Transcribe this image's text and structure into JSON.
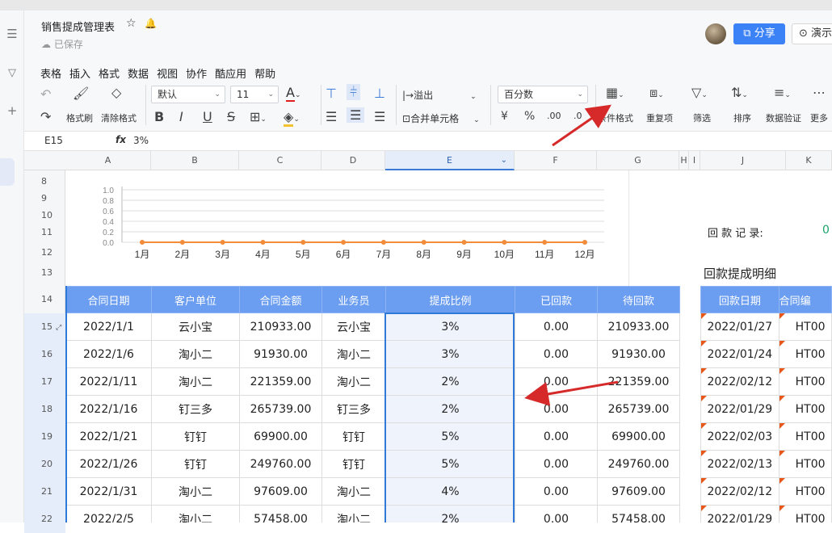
{
  "doc": {
    "title": "销售提成管理表",
    "saved": "已保存",
    "star_glyph": "☆",
    "bell_glyph": "🔔"
  },
  "header": {
    "share": "分享",
    "present": "演示"
  },
  "menu": [
    "表格",
    "插入",
    "格式",
    "数据",
    "视图",
    "协作",
    "酷应用",
    "帮助"
  ],
  "toolbar": {
    "format_painter": "格式刷",
    "clear_format": "清除格式",
    "font": "默认",
    "size": "11",
    "overflow": "溢出",
    "merge": "合并单元格",
    "number_format": "百分数",
    "cond_format": "条件格式",
    "duplicate": "重复项",
    "filter": "筛选",
    "sort": "排序",
    "validate": "数据验证",
    "more": "更多"
  },
  "formula_bar": {
    "cell": "E15",
    "fx": "fx",
    "value": "3%"
  },
  "columns": [
    {
      "id": "A"
    },
    {
      "id": "B"
    },
    {
      "id": "C"
    },
    {
      "id": "D"
    },
    {
      "id": "E"
    },
    {
      "id": "F"
    },
    {
      "id": "G"
    },
    {
      "id": "H"
    },
    {
      "id": "I"
    },
    {
      "id": "J"
    },
    {
      "id": "K"
    }
  ],
  "row_numbers": [
    "8",
    "9",
    "10",
    "11",
    "12",
    "13",
    "14",
    "15",
    "16",
    "17",
    "18",
    "19",
    "20",
    "21",
    "22"
  ],
  "chart_data": {
    "type": "line",
    "categories": [
      "1月",
      "2月",
      "3月",
      "4月",
      "5月",
      "6月",
      "7月",
      "8月",
      "9月",
      "10月",
      "11月",
      "12月"
    ],
    "series": [
      {
        "values": [
          0,
          0,
          0,
          0,
          0,
          0,
          0,
          0,
          0,
          0,
          0,
          0
        ],
        "color": "#f28c3a"
      }
    ],
    "y_ticks": [
      "1.0",
      "0.8",
      "0.6",
      "0.4",
      "0.2",
      "0.0"
    ],
    "ylim": [
      0,
      1.0
    ],
    "grid": true
  },
  "side": {
    "payment_label": "回 款 记 录:",
    "payment_value": "0",
    "detail_title": "回款提成明细"
  },
  "main_table": {
    "headers": [
      "合同日期",
      "客户单位",
      "合同金额",
      "业务员",
      "提成比例",
      "已回款",
      "待回款"
    ],
    "rows": [
      [
        "2022/1/1",
        "云小宝",
        "210933.00",
        "云小宝",
        "3%",
        "0.00",
        "210933.00"
      ],
      [
        "2022/1/6",
        "淘小二",
        "91930.00",
        "淘小二",
        "3%",
        "0.00",
        "91930.00"
      ],
      [
        "2022/1/11",
        "淘小二",
        "221359.00",
        "淘小二",
        "2%",
        "0.00",
        "221359.00"
      ],
      [
        "2022/1/16",
        "钉三多",
        "265739.00",
        "钉三多",
        "2%",
        "0.00",
        "265739.00"
      ],
      [
        "2022/1/21",
        "钉钉",
        "69900.00",
        "钉钉",
        "5%",
        "0.00",
        "69900.00"
      ],
      [
        "2022/1/26",
        "钉钉",
        "249760.00",
        "钉钉",
        "5%",
        "0.00",
        "249760.00"
      ],
      [
        "2022/1/31",
        "淘小二",
        "97609.00",
        "淘小二",
        "4%",
        "0.00",
        "97609.00"
      ],
      [
        "2022/2/5",
        "淘小二",
        "57458.00",
        "淘小二",
        "2%",
        "0.00",
        "57458.00"
      ]
    ]
  },
  "side_table": {
    "headers": [
      "回款日期",
      "合同编"
    ],
    "rows": [
      [
        "2022/01/27",
        "HT00"
      ],
      [
        "2022/01/24",
        "HT00"
      ],
      [
        "2022/02/12",
        "HT00"
      ],
      [
        "2022/01/29",
        "HT00"
      ],
      [
        "2022/02/03",
        "HT00"
      ],
      [
        "2022/02/13",
        "HT00"
      ],
      [
        "2022/02/12",
        "HT00"
      ],
      [
        "2022/01/29",
        "HT00"
      ]
    ]
  },
  "annotation_color": "#d62a2a"
}
